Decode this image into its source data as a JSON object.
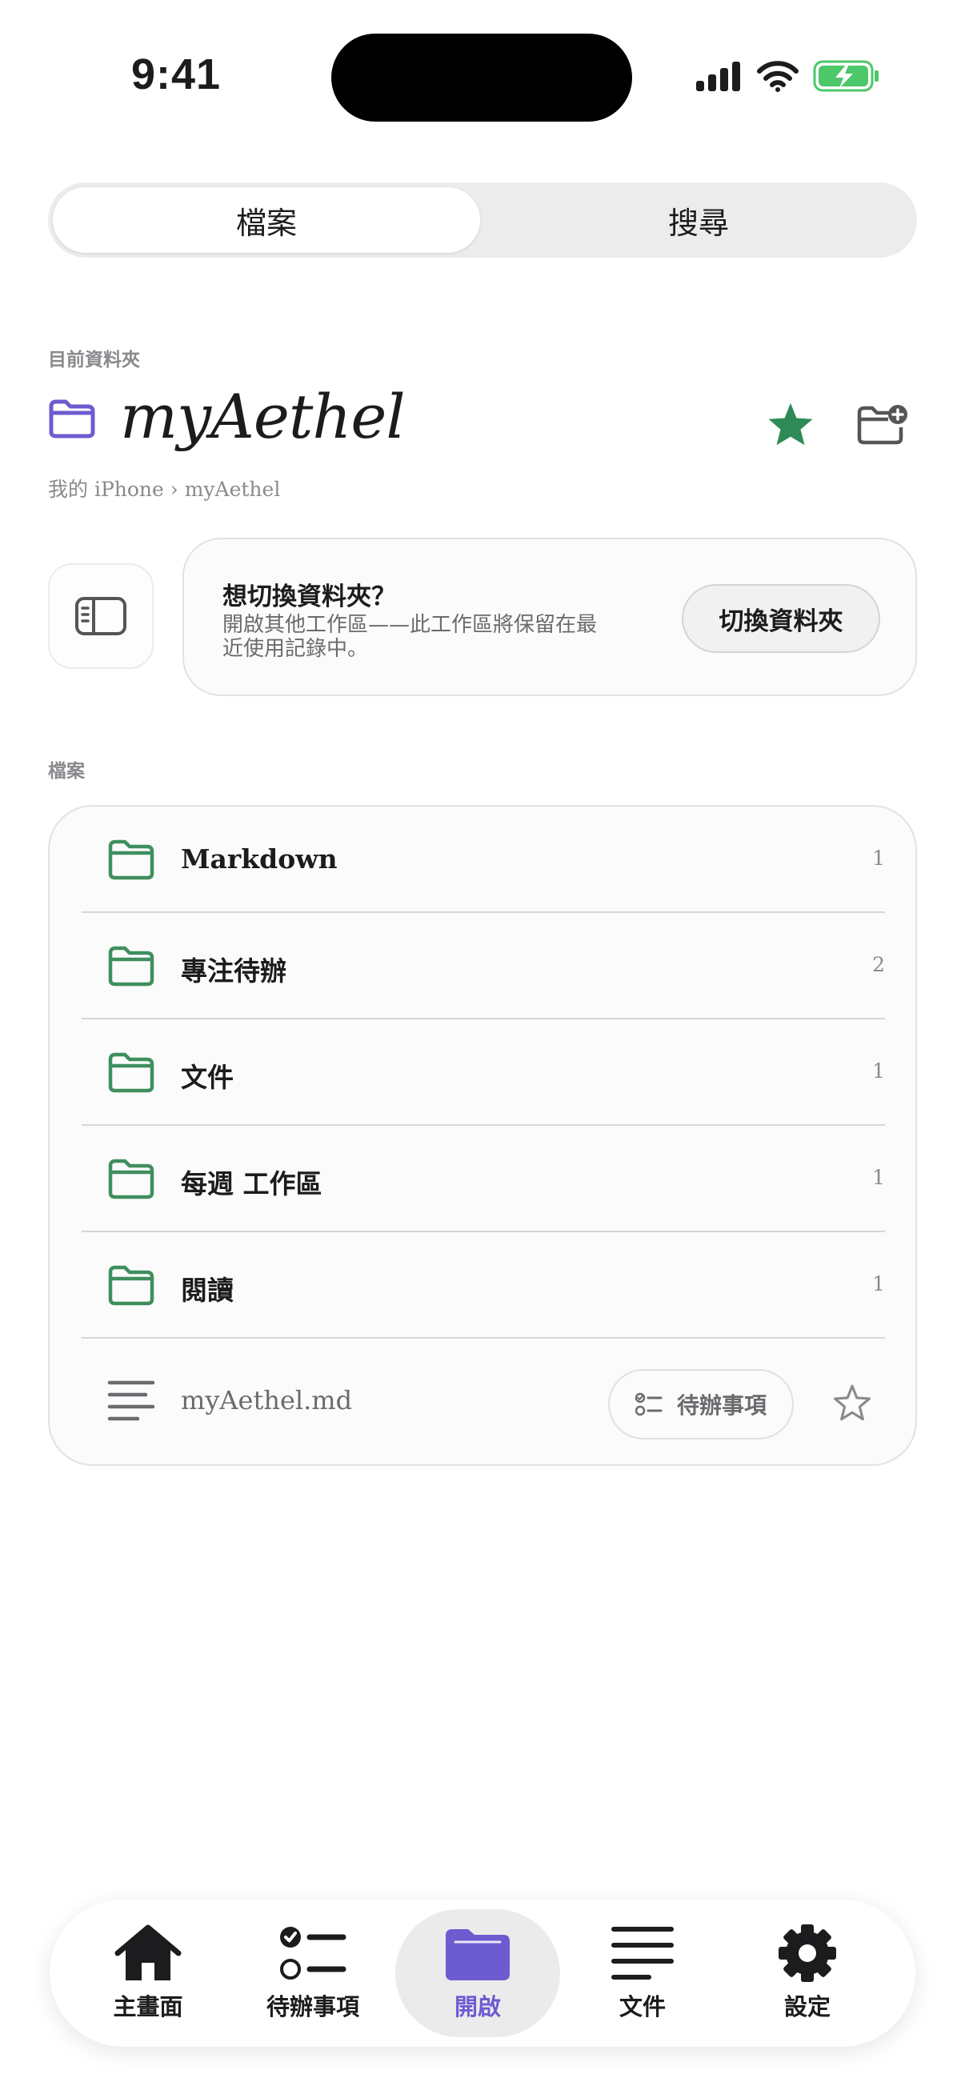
{
  "status_bar": {
    "time": "9:41"
  },
  "segmented": {
    "files_label": "檔案",
    "search_label": "搜尋"
  },
  "current_folder": {
    "section_label": "目前資料夾",
    "name": "myAethel",
    "breadcrumb": "我的 iPhone › myAethel",
    "accent_color": "#6d5bd0",
    "favorite_color": "#2e8b57"
  },
  "switch_card": {
    "title": "想切換資料夾？",
    "description": "開啟其他工作區——此工作區將保留在最近使用記錄中。",
    "button_label": "切換資料夾"
  },
  "files": {
    "section_label": "檔案",
    "folders": [
      {
        "name": "Markdown",
        "count": "1"
      },
      {
        "name": "專注待辦",
        "count": "2"
      },
      {
        "name": "文件",
        "count": "1"
      },
      {
        "name": "每週 工作區",
        "count": "1"
      },
      {
        "name": "閱讀",
        "count": "1"
      }
    ],
    "document": {
      "name": "myAethel.md",
      "todo_label": "待辦事項"
    },
    "folder_icon_color": "#3f8f5e"
  },
  "tab_bar": {
    "items": [
      {
        "label": "主畫面",
        "icon": "house-icon"
      },
      {
        "label": "待辦事項",
        "icon": "checklist-icon"
      },
      {
        "label": "開啟",
        "icon": "folder-icon",
        "active": true
      },
      {
        "label": "文件",
        "icon": "text-lines-icon"
      },
      {
        "label": "設定",
        "icon": "gear-icon"
      }
    ]
  }
}
